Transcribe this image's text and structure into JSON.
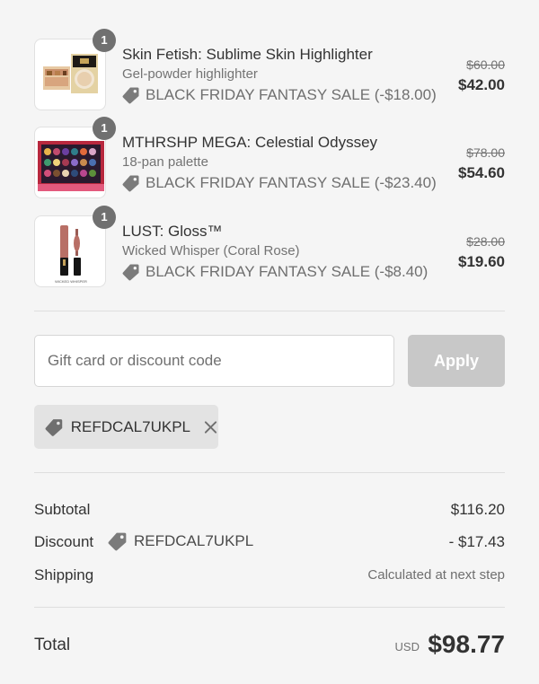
{
  "items": [
    {
      "quantity": "1",
      "name": "Skin Fetish: Sublime Skin Highlighter",
      "variant": "Gel-powder highlighter",
      "discount": "BLACK FRIDAY FANTASY SALE (-$18.00)",
      "original_price": "$60.00",
      "price": "$42.00"
    },
    {
      "quantity": "1",
      "name": "MTHRSHP MEGA: Celestial Odyssey",
      "variant": "18-pan palette",
      "discount": "BLACK FRIDAY FANTASY SALE (-$23.40)",
      "original_price": "$78.00",
      "price": "$54.60"
    },
    {
      "quantity": "1",
      "name": "LUST: Gloss™",
      "variant": "Wicked Whisper (Coral Rose)",
      "discount": "BLACK FRIDAY FANTASY SALE (-$8.40)",
      "original_price": "$28.00",
      "price": "$19.60",
      "thumb_caption": "WICKED WHISPER"
    }
  ],
  "discount_form": {
    "placeholder": "Gift card or discount code",
    "value": "",
    "apply_label": "Apply"
  },
  "applied_code": "REFDCAL7UKPL",
  "summary": {
    "subtotal_label": "Subtotal",
    "subtotal_value": "$116.20",
    "discount_label": "Discount",
    "discount_code": "REFDCAL7UKPL",
    "discount_value": "- $17.43",
    "shipping_label": "Shipping",
    "shipping_value": "Calculated at next step",
    "total_label": "Total",
    "currency": "USD",
    "total_value": "$98.77"
  },
  "colors": {
    "background": "#f5f5f5",
    "text": "#333333",
    "muted": "#737373",
    "apply_disabled": "#c8c8c8",
    "chip": "#e3e3e3",
    "badge": "#707070"
  }
}
